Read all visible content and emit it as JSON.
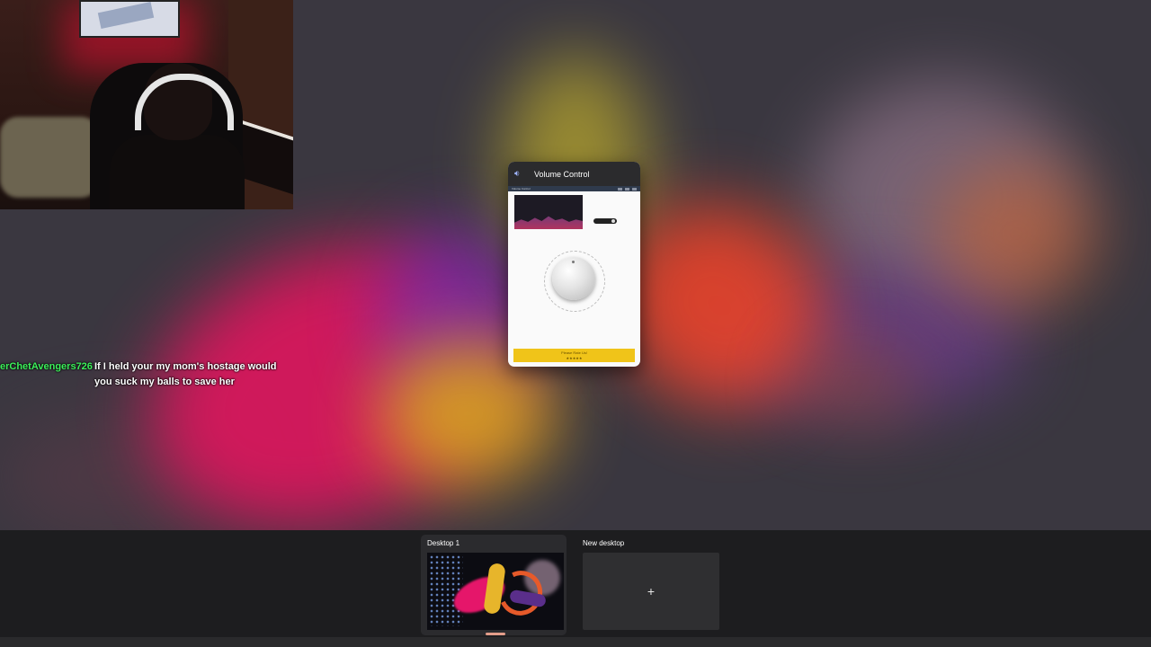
{
  "chat": {
    "username": "erChetAvengers726",
    "message": "If I held your my mom's hostage would you suck my balls to save her"
  },
  "volume_window": {
    "title": "Volume Control",
    "title_icon": "speaker-icon",
    "inner_title": "Volume Control",
    "rate_button_label": "Please Rate Us!",
    "rate_stars": "★★★★★"
  },
  "task_view": {
    "desktops": [
      {
        "label": "Desktop 1",
        "active": true
      },
      {
        "label": "New desktop",
        "plus_icon": "+"
      }
    ]
  },
  "colors": {
    "chat_username": "#3cf05b",
    "rate_button": "#f0c419",
    "active_indicator": "#e39d8a"
  }
}
